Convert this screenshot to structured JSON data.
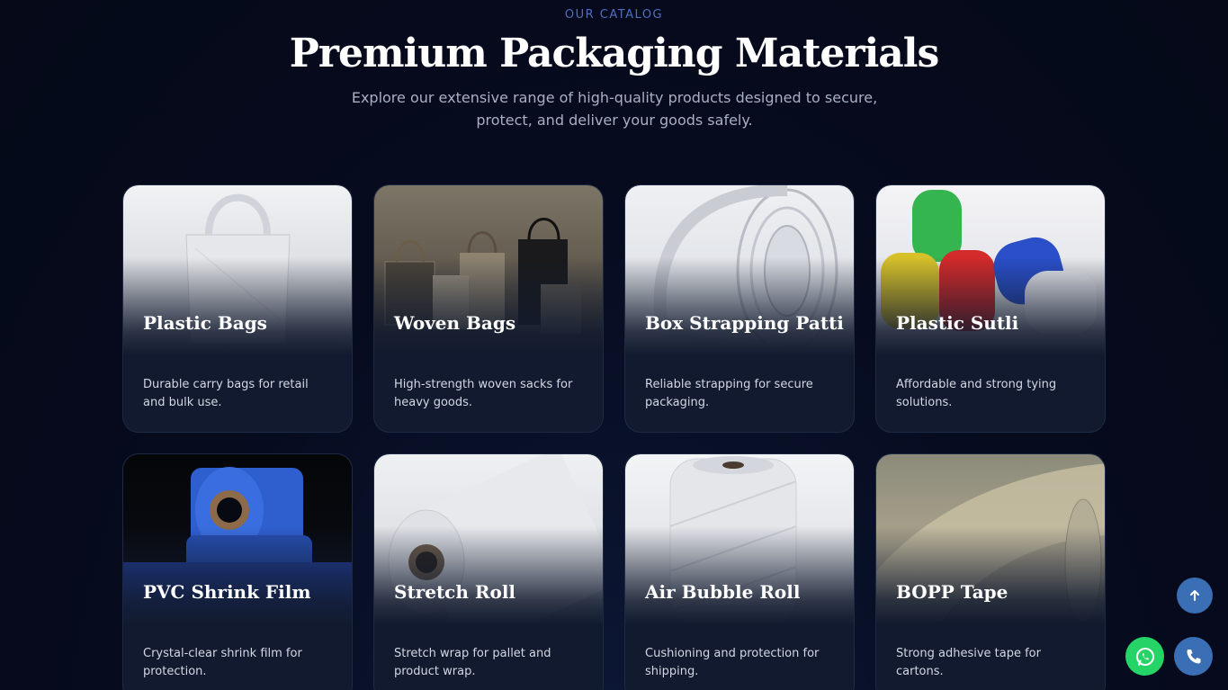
{
  "header": {
    "eyebrow": "OUR CATALOG",
    "title": "Premium Packaging Materials",
    "subtitle": "Explore our extensive range of high-quality products designed to secure, protect, and deliver your goods safely."
  },
  "products": [
    {
      "title": "Plastic Bags",
      "description": "Durable carry bags for retail and bulk use."
    },
    {
      "title": "Woven Bags",
      "description": "High-strength woven sacks for heavy goods."
    },
    {
      "title": "Box Strapping Patti",
      "description": "Reliable strapping for secure packaging."
    },
    {
      "title": "Plastic Sutli",
      "description": "Affordable and strong tying solutions."
    },
    {
      "title": "PVC Shrink Film",
      "description": "Crystal-clear shrink film for protection."
    },
    {
      "title": "Stretch Roll",
      "description": "Stretch wrap for pallet and product wrap."
    },
    {
      "title": "Air Bubble Roll",
      "description": "Cushioning and protection for shipping."
    },
    {
      "title": "BOPP Tape",
      "description": "Strong adhesive tape for cartons."
    }
  ],
  "floating_buttons": {
    "scroll_top_icon": "arrow-up-icon",
    "whatsapp_icon": "whatsapp-icon",
    "call_icon": "phone-icon",
    "whatsapp_color": "#25d366",
    "accent_color": "#3a6fb5"
  }
}
